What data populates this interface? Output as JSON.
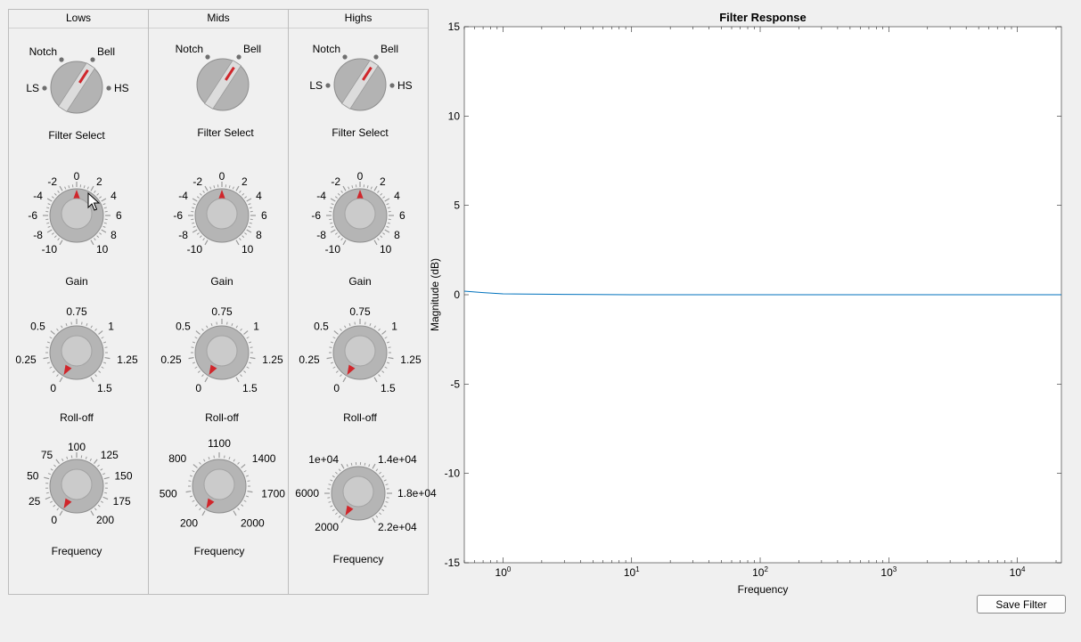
{
  "panels": [
    {
      "title": "Lows",
      "filter_select": {
        "label": "Filter Select",
        "options": [
          "Notch",
          "Bell",
          "LS",
          "HS"
        ]
      },
      "gain": {
        "label": "Gain",
        "ticks": [
          "-10",
          "-8",
          "-6",
          "-4",
          "-2",
          "0",
          "2",
          "4",
          "6",
          "8",
          "10"
        ],
        "value": 0
      },
      "rolloff": {
        "label": "Roll-off",
        "ticks": [
          "0",
          "0.25",
          "0.5",
          "0.75",
          "1",
          "1.25",
          "1.5"
        ],
        "value": 0
      },
      "frequency": {
        "label": "Frequency",
        "ticks": [
          "0",
          "25",
          "50",
          "75",
          "100",
          "125",
          "150",
          "175",
          "200"
        ],
        "value": 0
      }
    },
    {
      "title": "Mids",
      "filter_select": {
        "label": "Filter Select",
        "options": [
          "Notch",
          "Bell"
        ]
      },
      "gain": {
        "label": "Gain",
        "ticks": [
          "-10",
          "-8",
          "-6",
          "-4",
          "-2",
          "0",
          "2",
          "4",
          "6",
          "8",
          "10"
        ],
        "value": 0
      },
      "rolloff": {
        "label": "Roll-off",
        "ticks": [
          "0",
          "0.25",
          "0.5",
          "0.75",
          "1",
          "1.25",
          "1.5"
        ],
        "value": 0
      },
      "frequency": {
        "label": "Frequency",
        "ticks": [
          "200",
          "500",
          "800",
          "1100",
          "1400",
          "1700",
          "2000"
        ],
        "value": 200
      }
    },
    {
      "title": "Highs",
      "filter_select": {
        "label": "Filter Select",
        "options": [
          "Notch",
          "Bell",
          "LS",
          "HS"
        ]
      },
      "gain": {
        "label": "Gain",
        "ticks": [
          "-10",
          "-8",
          "-6",
          "-4",
          "-2",
          "0",
          "2",
          "4",
          "6",
          "8",
          "10"
        ],
        "value": 0
      },
      "rolloff": {
        "label": "Roll-off",
        "ticks": [
          "0",
          "0.25",
          "0.5",
          "0.75",
          "1",
          "1.25",
          "1.5"
        ],
        "value": 0
      },
      "frequency": {
        "label": "Frequency",
        "ticks": [
          "2000",
          "6000",
          "1e+04",
          "1.4e+04",
          "1.8e+04",
          "2.2e+04"
        ],
        "value": 2000
      }
    }
  ],
  "save_button": "Save Filter",
  "chart_data": {
    "type": "line",
    "title": "Filter Response",
    "xlabel": "Frequency",
    "ylabel": "Magnitude (dB)",
    "xscale": "log",
    "xlim": [
      0.5,
      22000
    ],
    "ylim": [
      -15,
      15
    ],
    "yticks": [
      "-15",
      "-10",
      "-5",
      "0",
      "5",
      "10",
      "15"
    ],
    "xticks": [
      {
        "value": 1,
        "base": "10",
        "exp": "0"
      },
      {
        "value": 10,
        "base": "10",
        "exp": "1"
      },
      {
        "value": 100,
        "base": "10",
        "exp": "2"
      },
      {
        "value": 1000,
        "base": "10",
        "exp": "3"
      },
      {
        "value": 10000,
        "base": "10",
        "exp": "4"
      }
    ],
    "grid": false,
    "series": [
      {
        "color": "#0072bd",
        "x": [
          0.5,
          0.7,
          1,
          1.5,
          2,
          3,
          5,
          10,
          100,
          1000,
          10000,
          22000
        ],
        "y": [
          0.2,
          0.12,
          0.05,
          0.04,
          0.03,
          0.02,
          0.01,
          0,
          0,
          0,
          0,
          0
        ]
      }
    ]
  }
}
